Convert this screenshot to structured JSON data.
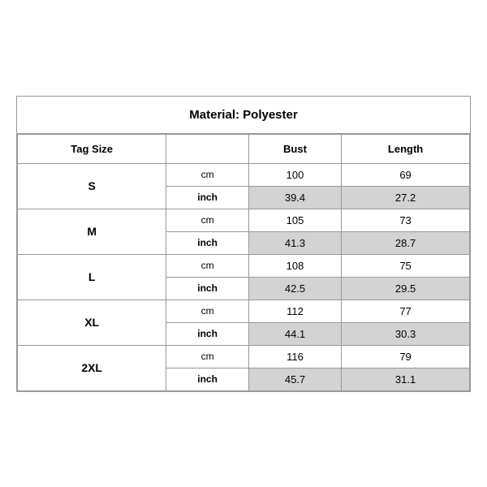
{
  "title": "Material: Polyester",
  "headers": {
    "tag_size": "Tag Size",
    "bust": "Bust",
    "length": "Length"
  },
  "rows": [
    {
      "size": "S",
      "cm": {
        "bust": "100",
        "length": "69"
      },
      "inch": {
        "bust": "39.4",
        "length": "27.2"
      }
    },
    {
      "size": "M",
      "cm": {
        "bust": "105",
        "length": "73"
      },
      "inch": {
        "bust": "41.3",
        "length": "28.7"
      }
    },
    {
      "size": "L",
      "cm": {
        "bust": "108",
        "length": "75"
      },
      "inch": {
        "bust": "42.5",
        "length": "29.5"
      }
    },
    {
      "size": "XL",
      "cm": {
        "bust": "112",
        "length": "77"
      },
      "inch": {
        "bust": "44.1",
        "length": "30.3"
      }
    },
    {
      "size": "2XL",
      "cm": {
        "bust": "116",
        "length": "79"
      },
      "inch": {
        "bust": "45.7",
        "length": "31.1"
      }
    }
  ]
}
